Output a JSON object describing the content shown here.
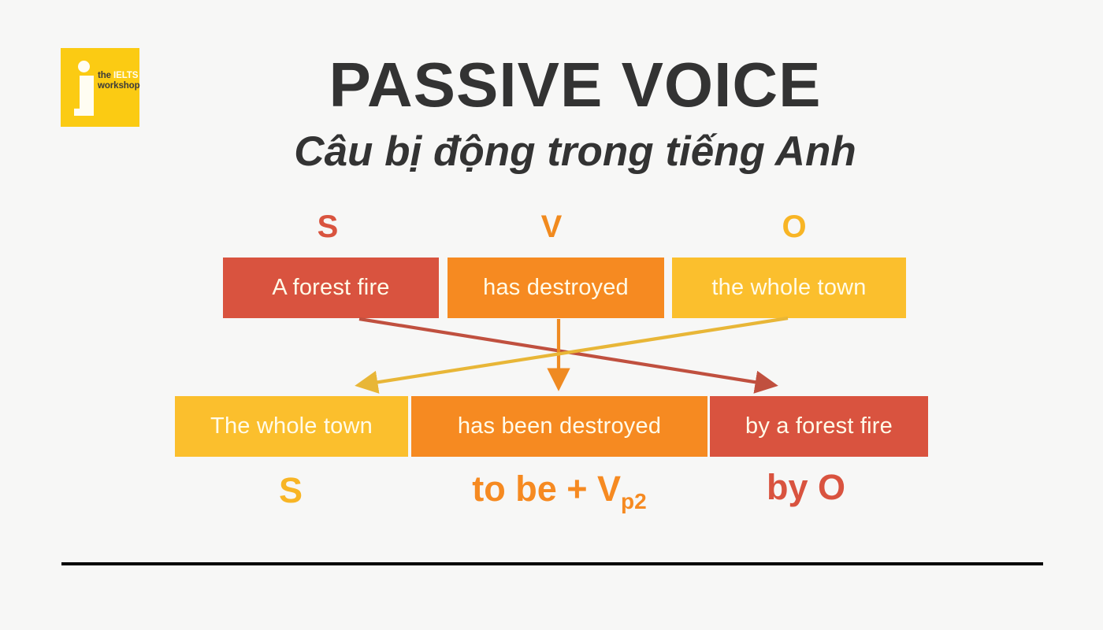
{
  "logo": {
    "name": "the-ielts-workshop-logo",
    "line1_a": "the ",
    "line1_b": "IELTS",
    "line2": "workshop",
    "background_color": "#FBCB13",
    "mark_color": "#FFFDF2"
  },
  "header": {
    "title": "PASSIVE VOICE",
    "subtitle": "Câu bị động trong tiếng Anh",
    "title_color": "#333333"
  },
  "active_sentence": {
    "role_labels": {
      "subject": "S",
      "verb": "V",
      "object": "O"
    },
    "boxes": [
      {
        "text": "A forest fire",
        "role": "S",
        "color": "#D9533F"
      },
      {
        "text": "has destroyed",
        "role": "V",
        "color": "#F68A21"
      },
      {
        "text": "the whole town",
        "role": "O",
        "color": "#FBBF2D"
      }
    ]
  },
  "passive_sentence": {
    "boxes": [
      {
        "text": "The whole town",
        "role": "S",
        "color": "#FBBF2D"
      },
      {
        "text": "has been destroyed",
        "role": "to be + Vp2",
        "color": "#F68A21"
      },
      {
        "text": "by a forest fire",
        "role": "by O",
        "color": "#D9533F"
      }
    ],
    "role_labels": {
      "subject": "S",
      "verb_main": "to be + V",
      "verb_sub": "p2",
      "agent": "by O"
    }
  },
  "arrows": [
    {
      "name": "subject-to-agent-arrow",
      "color": "#C0503F",
      "from": "A forest fire",
      "to": "by a forest fire"
    },
    {
      "name": "verb-to-verb-arrow",
      "color": "#EF8A22",
      "from": "has destroyed",
      "to": "has been destroyed"
    },
    {
      "name": "object-to-subject-arrow",
      "color": "#E8B637",
      "from": "the whole town",
      "to": "The whole town"
    }
  ],
  "divider": {
    "color": "#000000"
  },
  "canvas": {
    "background_color": "#F7F7F6"
  }
}
